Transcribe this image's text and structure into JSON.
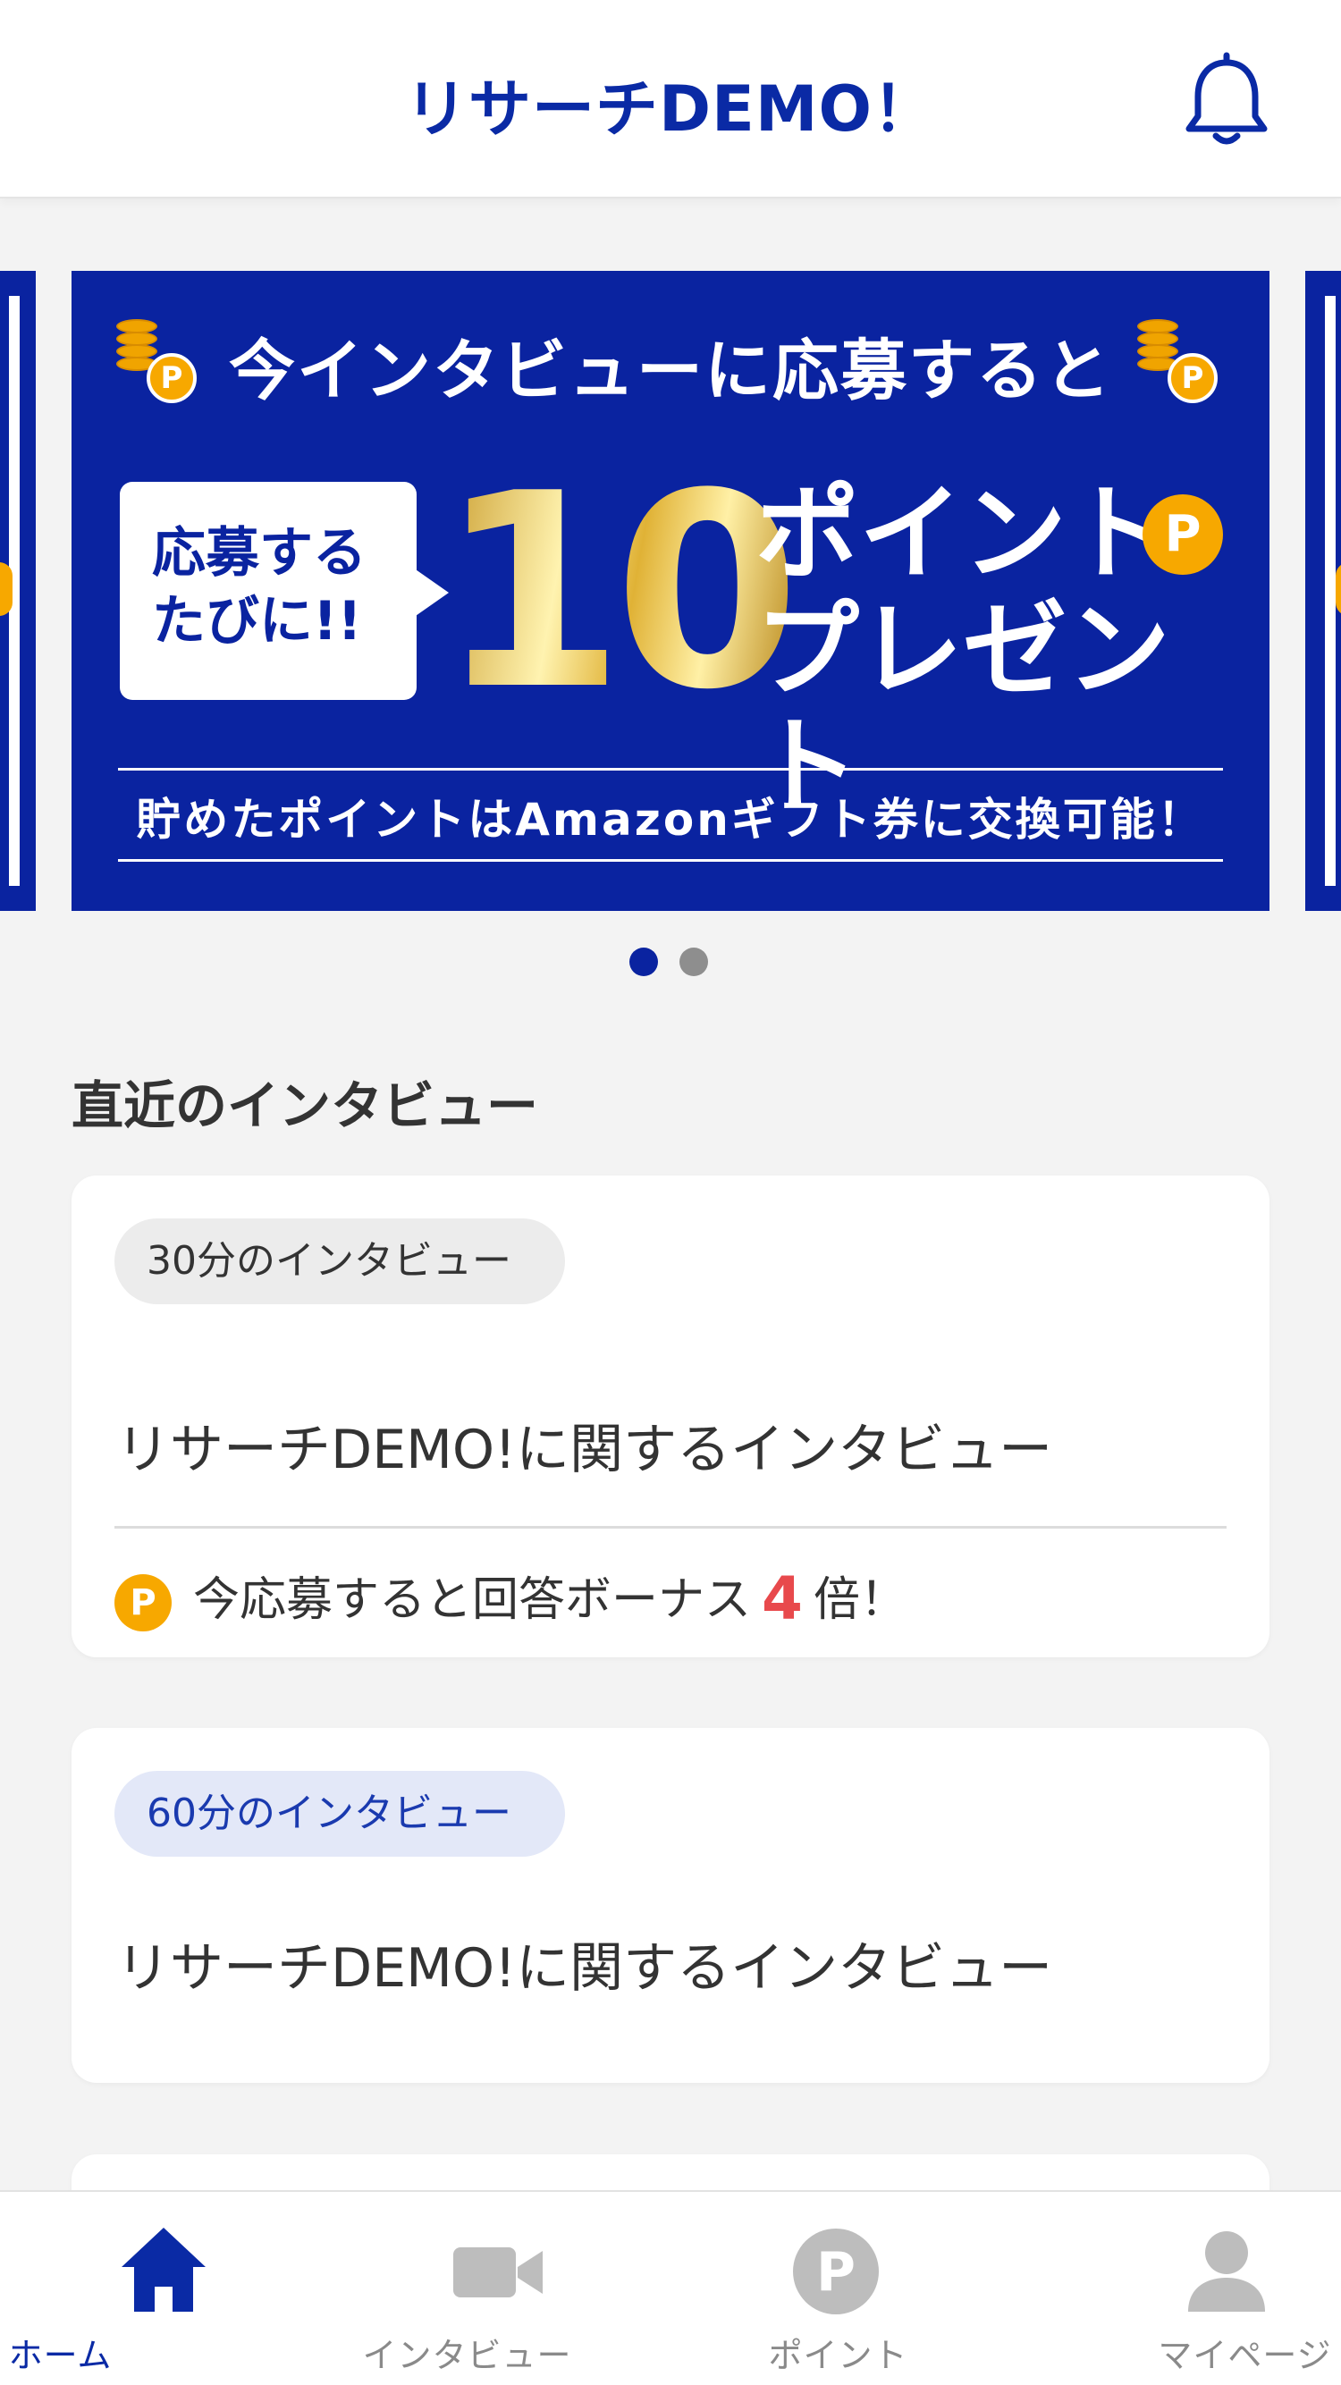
{
  "header": {
    "title": "リサーチDEMO！"
  },
  "banner": {
    "headline": "今インタビューに応募すると",
    "bubble_line1": "応募する",
    "bubble_line2": "たびに!!",
    "big_number": "10",
    "point_line1": "ポイント",
    "point_line2": "プレゼント",
    "coin_letter": "P",
    "footer": "貯めたポイントはAmazonギフト券に交換可能！",
    "page_count": 2,
    "active_page": 1
  },
  "section": {
    "title": "直近のインタビュー"
  },
  "interviews": [
    {
      "tag": "30分のインタビュー",
      "title": "リサーチDEMO!に関するインタビュー",
      "bonus_prefix": "今応募すると回答ボーナス",
      "bonus_multiplier": "4",
      "bonus_suffix": "倍！",
      "coin_letter": "P"
    },
    {
      "tag": "60分のインタビュー",
      "title": "リサーチDEMO!に関するインタビュー"
    }
  ],
  "tabbar": {
    "tabs": [
      {
        "label": "ホーム",
        "icon": "home-icon",
        "active": true
      },
      {
        "label": "インタビュー",
        "icon": "video-camera-icon",
        "active": false
      },
      {
        "label": "ポイント",
        "icon": "point-coin-icon",
        "active": false,
        "icon_letter": "P"
      },
      {
        "label": "マイページ",
        "icon": "person-icon",
        "active": false
      }
    ]
  },
  "colors": {
    "brand_blue": "#0a23a0",
    "accent_orange": "#f7a800",
    "bonus_red": "#e8494c",
    "inactive_gray": "#8a8a8a"
  }
}
